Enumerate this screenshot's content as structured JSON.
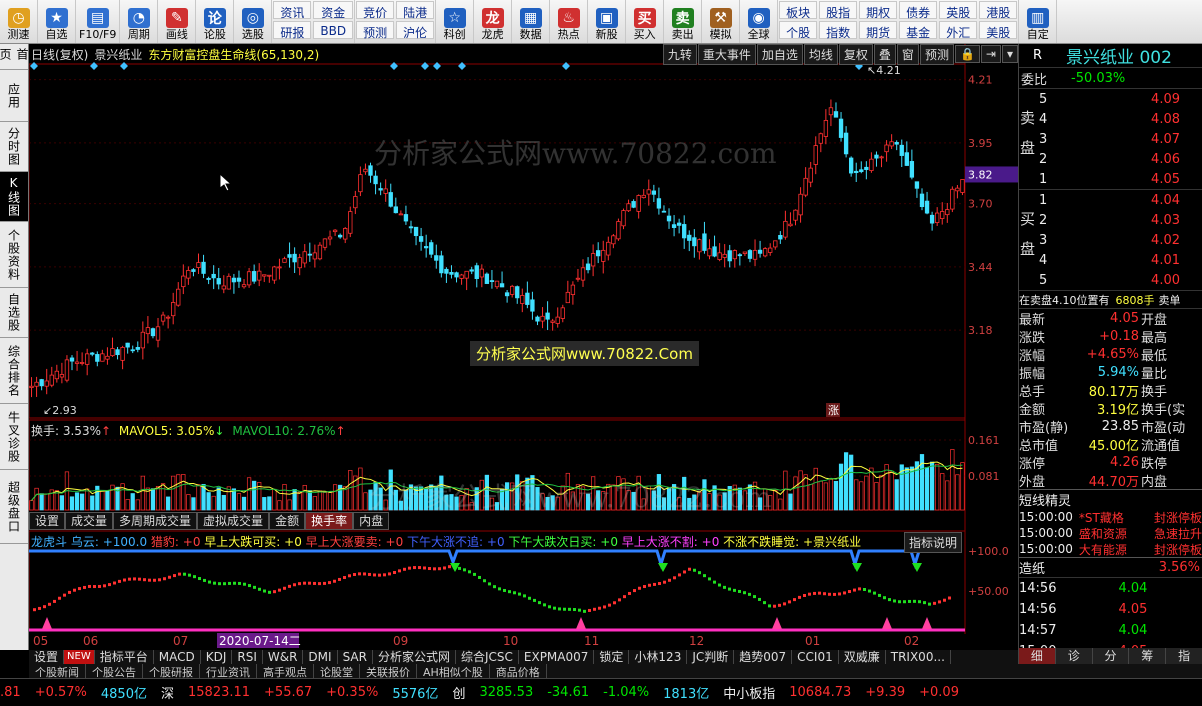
{
  "toolbar": {
    "buttons": [
      {
        "label": "测速",
        "icon": "clock-icon",
        "color": "#e0a020"
      },
      {
        "label": "自选",
        "icon": "star-icon",
        "color": "#3070d0"
      },
      {
        "label": "F10/F9",
        "icon": "f10-icon",
        "color": "#3070d0"
      },
      {
        "label": "周期",
        "icon": "period-icon",
        "color": "#3070d0"
      },
      {
        "label": "画线",
        "icon": "pen-icon",
        "color": "#d03030"
      },
      {
        "label": "论股",
        "icon": "discuss-icon",
        "color": "#2060c0"
      },
      {
        "label": "选股",
        "icon": "select-stock-icon",
        "color": "#2060c0"
      }
    ],
    "grid1": [
      "资讯",
      "资金",
      "研报",
      "BBD"
    ],
    "grid2": [
      "竞价",
      "陆港",
      "预测",
      "沪伦"
    ],
    "buttons2": [
      {
        "label": "科创",
        "icon": "star-market-icon",
        "color": "#2060c0"
      },
      {
        "label": "龙虎",
        "icon": "dragon-tiger-icon",
        "color": "#d03030"
      },
      {
        "label": "数据",
        "icon": "data-icon",
        "color": "#2060c0"
      },
      {
        "label": "热点",
        "icon": "hot-icon",
        "color": "#d03030"
      },
      {
        "label": "新股",
        "icon": "new-stock-icon",
        "color": "#2060c0"
      },
      {
        "label": "买入",
        "icon": "buy-icon",
        "color": "#d03030"
      },
      {
        "label": "卖出",
        "icon": "sell-icon",
        "color": "#208020"
      },
      {
        "label": "模拟",
        "icon": "hammer-icon",
        "color": "#a06020"
      },
      {
        "label": "全球",
        "icon": "globe-icon",
        "color": "#2060c0"
      }
    ],
    "grid3": [
      "板块",
      "股指",
      "期权",
      "债券",
      "英股",
      "港股",
      "个股",
      "指数",
      "期货",
      "基金",
      "外汇",
      "美股"
    ],
    "last": {
      "label": "自定",
      "icon": "custom-icon",
      "color": "#2060c0"
    }
  },
  "sidebar": [
    "首页",
    "应用",
    "分时图",
    "K线图",
    "个股资料",
    "自选股",
    "综合排名",
    "牛叉诊股",
    "超级盘口"
  ],
  "chart": {
    "header_left": "日线(复权)",
    "stock_name": "景兴纸业",
    "formula": "东方财富控盘生命线(65,130,2)",
    "tools": [
      "九转",
      "重大事件",
      "加自选",
      "均线",
      "复权",
      "叠",
      "窗",
      "预测"
    ],
    "price_axis": [
      "4.21",
      "3.95",
      "3.70",
      "3.44",
      "3.18"
    ],
    "price_axis_values": [
      4.21,
      3.95,
      3.7,
      3.44,
      3.18
    ],
    "current_price_tag": "3.82",
    "high_label": "4.21",
    "low_label": "2.93",
    "zhang_label": "涨",
    "watermark1": "分析家公式网www.70822.com",
    "watermark2": "分析家公式网www.70822.Com",
    "turnover_label": "换手: 3.53%",
    "mavol5": "MAVOL5: 3.05%",
    "mavol10": "MAVOL10: 2.76%",
    "vol_axis": [
      "0.161",
      "0.081"
    ],
    "tabs": [
      "设置",
      "成交量",
      "多周期成交量",
      "虚拟成交量",
      "金额",
      "换手率",
      "内盘"
    ],
    "active_tab": 5,
    "indicator_items": [
      {
        "text": "龙虎斗 乌云: ",
        "color": "#40b0ff"
      },
      {
        "text": "+100.0 ",
        "color": "#40b0ff"
      },
      {
        "text": "猎豹: ",
        "color": "#ff4040"
      },
      {
        "text": "+0 ",
        "color": "#ff4040"
      },
      {
        "text": "早上大跌可买: ",
        "color": "#ffff40"
      },
      {
        "text": "+0 ",
        "color": "#ffff40"
      },
      {
        "text": "早上大涨要卖: ",
        "color": "#ff4040"
      },
      {
        "text": "+0 ",
        "color": "#ff4040"
      },
      {
        "text": "下午大涨不追: ",
        "color": "#4060ff"
      },
      {
        "text": "+0 ",
        "color": "#4060ff"
      },
      {
        "text": "下午大跌次日买: ",
        "color": "#40ff40"
      },
      {
        "text": "+0 ",
        "color": "#40ff40"
      },
      {
        "text": "早上大涨不割: ",
        "color": "#ff40ff"
      },
      {
        "text": "+0 ",
        "color": "#ff40ff"
      },
      {
        "text": "不涨不跌睡觉: ",
        "color": "#ffff40"
      },
      {
        "text": "+景兴纸业",
        "color": "#ffff40"
      }
    ],
    "indicator_help": "指标说明",
    "ind_axis": [
      "+100.0",
      "+50.00"
    ],
    "date_labels": [
      "05",
      "06",
      "07",
      "2020-07-14二",
      "09",
      "10",
      "11",
      "12",
      "01",
      "02"
    ]
  },
  "bottomtabs": [
    "设置",
    "NEW",
    "指标平台",
    "MACD",
    "KDJ",
    "RSI",
    "W&R",
    "DMI",
    "SAR",
    "分析家公式网",
    "综合JCSC",
    "EXPMA007",
    "锁定",
    "小林123",
    "JC判断",
    "趋势007",
    "CCI01",
    "双威廉",
    "TRIX00..."
  ],
  "newsbar": [
    "个股新闻",
    "个股公告",
    "个股研报",
    "行业资讯",
    "高手观点",
    "论股堂",
    "关联报价",
    "AH相似个股",
    "商品价格"
  ],
  "right": {
    "code_prefix": "R",
    "title": "景兴纸业 002",
    "weibi_label": "委比",
    "weibi": "-50.03%",
    "sell": [
      {
        "n": "5",
        "p": "4.09"
      },
      {
        "n": "4",
        "p": "4.08"
      },
      {
        "n": "3",
        "p": "4.07"
      },
      {
        "n": "2",
        "p": "4.06"
      },
      {
        "n": "1",
        "p": "4.05"
      }
    ],
    "buy": [
      {
        "n": "1",
        "p": "4.04"
      },
      {
        "n": "2",
        "p": "4.03"
      },
      {
        "n": "3",
        "p": "4.02"
      },
      {
        "n": "4",
        "p": "4.01"
      },
      {
        "n": "5",
        "p": "4.00"
      }
    ],
    "sell_label": "卖盘",
    "buy_label": "买盘",
    "pending_text": "在卖盘4.10位置有",
    "pending_vol": "6808手",
    "pending_suffix": "卖单",
    "quotes": [
      {
        "l": "最新",
        "v": "4.05",
        "c": "r",
        "l2": "开盘"
      },
      {
        "l": "涨跌",
        "v": "+0.18",
        "c": "r",
        "l2": "最高"
      },
      {
        "l": "涨幅",
        "v": "+4.65%",
        "c": "r",
        "l2": "最低"
      },
      {
        "l": "振幅",
        "v": "5.94%",
        "c": "c",
        "l2": "量比"
      },
      {
        "l": "总手",
        "v": "80.17万",
        "c": "y",
        "l2": "换手"
      },
      {
        "l": "金额",
        "v": "3.19亿",
        "c": "y",
        "l2": "换手(实"
      },
      {
        "l": "市盈(静)",
        "v": "23.85",
        "c": "w",
        "l2": "市盈(动"
      },
      {
        "l": "总市值",
        "v": "45.00亿",
        "c": "y",
        "l2": "流通值"
      },
      {
        "l": "涨停",
        "v": "4.26",
        "c": "r",
        "l2": "跌停"
      },
      {
        "l": "外盘",
        "v": "44.70万",
        "c": "r",
        "l2": "内盘"
      }
    ],
    "short_title": "短线精灵",
    "short": [
      {
        "t": "15:00:00",
        "n": "*ST藏格",
        "s": "封涨停板"
      },
      {
        "t": "15:00:00",
        "n": "盛和资源",
        "s": "急速拉升"
      },
      {
        "t": "15:00:00",
        "n": "大有能源",
        "s": "封涨停板"
      }
    ],
    "paper_label": "造纸",
    "paper_pct": "3.56%",
    "ticks": [
      {
        "t": "14:56",
        "p": "4.04"
      },
      {
        "t": "14:56",
        "p": "4.05"
      },
      {
        "t": "14:57",
        "p": "4.04"
      },
      {
        "t": "15:00",
        "p": "4.05"
      }
    ],
    "rtabs": [
      "细",
      "诊",
      "分",
      "筹",
      "指"
    ]
  },
  "status": [
    {
      "text": ".81",
      "c": "r"
    },
    {
      "text": "+0.57%",
      "c": "r"
    },
    {
      "text": "4850亿",
      "c": "c"
    },
    {
      "text": "深",
      "c": "w"
    },
    {
      "text": "15823.11",
      "c": "r"
    },
    {
      "text": "+55.67",
      "c": "r"
    },
    {
      "text": "+0.35%",
      "c": "r"
    },
    {
      "text": "5576亿",
      "c": "c"
    },
    {
      "text": "创",
      "c": "w"
    },
    {
      "text": "3285.53",
      "c": "g"
    },
    {
      "text": "-34.61",
      "c": "g"
    },
    {
      "text": "-1.04%",
      "c": "g"
    },
    {
      "text": "1813亿",
      "c": "c"
    },
    {
      "text": "中小板指",
      "c": "w"
    },
    {
      "text": "10684.73",
      "c": "r"
    },
    {
      "text": "+9.39",
      "c": "r"
    },
    {
      "text": "+0.09",
      "c": "r"
    }
  ]
}
